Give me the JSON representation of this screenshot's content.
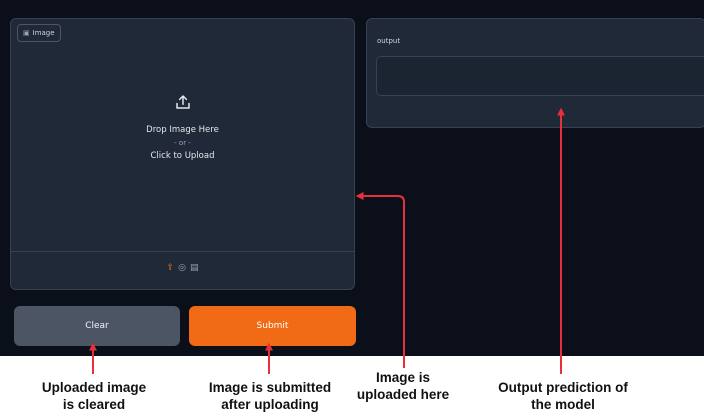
{
  "image_panel": {
    "label": "Image",
    "label_icon": "image-icon",
    "drop_text": "Drop Image Here",
    "or_text": "- or -",
    "click_text": "Click to Upload",
    "source_icons": [
      "upload-icon",
      "webcam-icon",
      "clipboard-icon"
    ]
  },
  "buttons": {
    "clear": "Clear",
    "submit": "Submit"
  },
  "output_panel": {
    "label": "output",
    "value": ""
  },
  "annotations": {
    "clear": [
      "Uploaded image",
      "is cleared"
    ],
    "submit": [
      "Image is submitted",
      "after uploading"
    ],
    "upload": [
      "Image is",
      "uploaded here"
    ],
    "output": [
      "Output prediction of",
      "the model"
    ]
  },
  "colors": {
    "background": "#0b0f19",
    "panel": "#1f2937",
    "submit": "#f16a16",
    "clear": "#4b5563",
    "arrow": "#e8303a"
  }
}
